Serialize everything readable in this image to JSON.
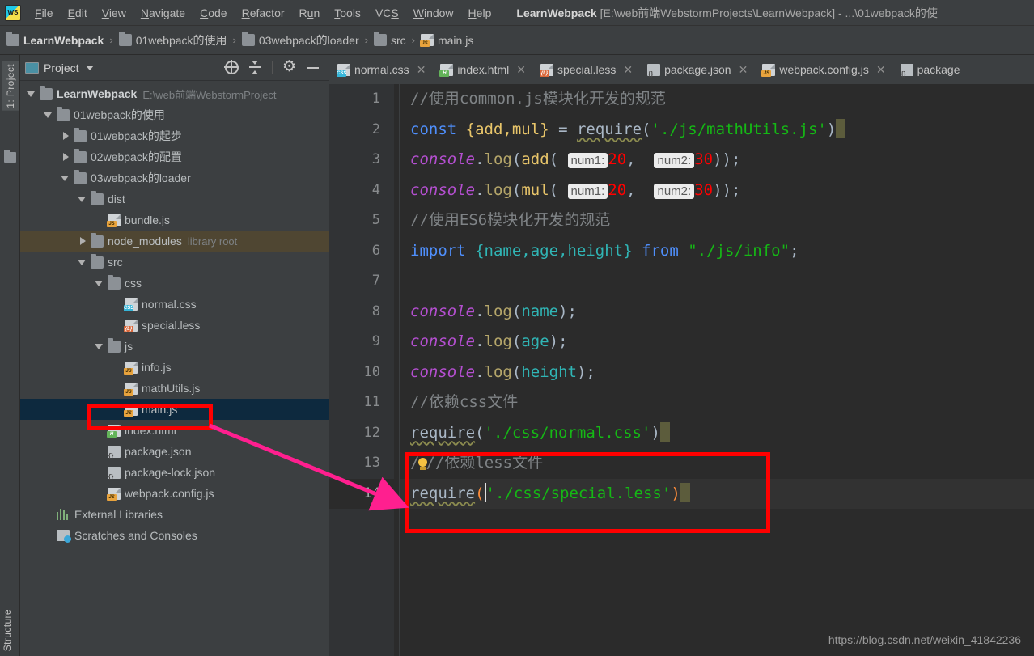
{
  "window": {
    "title_project": "LearnWebpack",
    "title_path": "[E:\\web前端WebstormProjects\\LearnWebpack] - ...\\01webpack的使",
    "logo": "webstorm-logo"
  },
  "menubar": {
    "items": [
      {
        "label": "File",
        "mnemonic": "F"
      },
      {
        "label": "Edit",
        "mnemonic": "E"
      },
      {
        "label": "View",
        "mnemonic": "V"
      },
      {
        "label": "Navigate",
        "mnemonic": "N"
      },
      {
        "label": "Code",
        "mnemonic": "C"
      },
      {
        "label": "Refactor",
        "mnemonic": "R"
      },
      {
        "label": "Run",
        "mnemonic": "u"
      },
      {
        "label": "Tools",
        "mnemonic": "T"
      },
      {
        "label": "VCS",
        "mnemonic": "S"
      },
      {
        "label": "Window",
        "mnemonic": "W"
      },
      {
        "label": "Help",
        "mnemonic": "H"
      }
    ]
  },
  "breadcrumb": {
    "items": [
      {
        "label": "LearnWebpack",
        "icon": "folder-icon",
        "bold": true
      },
      {
        "label": "01webpack的使用",
        "icon": "folder-icon",
        "bold": false
      },
      {
        "label": "03webpack的loader",
        "icon": "folder-icon",
        "bold": false
      },
      {
        "label": "src",
        "icon": "folder-icon",
        "bold": false
      },
      {
        "label": "main.js",
        "icon": "js-file-icon",
        "bold": false
      }
    ],
    "separator": "›"
  },
  "toolstrip": {
    "top_tab": "1: Project",
    "top_tab_mnemonic": "1",
    "bottom_tab": "Structure"
  },
  "project_panel": {
    "title": "Project",
    "tools": [
      "locate-icon",
      "collapse-all-icon",
      "settings-gear-icon",
      "minimize-icon"
    ],
    "tree": [
      {
        "label": "LearnWebpack",
        "sub": "E:\\web前端WebstormProject",
        "indent": 0,
        "twist": "open",
        "icon": "folder-icon",
        "bold": true,
        "state": "normal"
      },
      {
        "label": "01webpack的使用",
        "sub": "",
        "indent": 1,
        "twist": "open",
        "icon": "folder-icon",
        "bold": false,
        "state": "normal"
      },
      {
        "label": "01webpack的起步",
        "sub": "",
        "indent": 2,
        "twist": "closed",
        "icon": "folder-icon",
        "bold": false,
        "state": "normal"
      },
      {
        "label": "02webpack的配置",
        "sub": "",
        "indent": 2,
        "twist": "closed",
        "icon": "folder-icon",
        "bold": false,
        "state": "normal"
      },
      {
        "label": "03webpack的loader",
        "sub": "",
        "indent": 2,
        "twist": "open",
        "icon": "folder-icon",
        "bold": false,
        "state": "normal"
      },
      {
        "label": "dist",
        "sub": "",
        "indent": 3,
        "twist": "open",
        "icon": "folder-icon",
        "bold": false,
        "state": "normal"
      },
      {
        "label": "bundle.js",
        "sub": "",
        "indent": 4,
        "twist": "none",
        "icon": "js-file-icon",
        "bold": false,
        "state": "normal"
      },
      {
        "label": "node_modules",
        "sub": "library root",
        "indent": 3,
        "twist": "closed",
        "icon": "folder-icon",
        "bold": false,
        "state": "library"
      },
      {
        "label": "src",
        "sub": "",
        "indent": 3,
        "twist": "open",
        "icon": "folder-icon",
        "bold": false,
        "state": "normal"
      },
      {
        "label": "css",
        "sub": "",
        "indent": 4,
        "twist": "open",
        "icon": "folder-icon",
        "bold": false,
        "state": "normal"
      },
      {
        "label": "normal.css",
        "sub": "",
        "indent": 5,
        "twist": "none",
        "icon": "css-file-icon",
        "bold": false,
        "state": "normal"
      },
      {
        "label": "special.less",
        "sub": "",
        "indent": 5,
        "twist": "none",
        "icon": "less-file-icon",
        "bold": false,
        "state": "normal"
      },
      {
        "label": "js",
        "sub": "",
        "indent": 4,
        "twist": "open",
        "icon": "folder-icon",
        "bold": false,
        "state": "normal"
      },
      {
        "label": "info.js",
        "sub": "",
        "indent": 5,
        "twist": "none",
        "icon": "js-file-icon",
        "bold": false,
        "state": "normal"
      },
      {
        "label": "mathUtils.js",
        "sub": "",
        "indent": 5,
        "twist": "none",
        "icon": "js-file-icon",
        "bold": false,
        "state": "normal"
      },
      {
        "label": "main.js",
        "sub": "",
        "indent": 5,
        "twist": "none",
        "icon": "js-file-icon",
        "bold": false,
        "state": "selected"
      },
      {
        "label": "index.html",
        "sub": "",
        "indent": 4,
        "twist": "none",
        "icon": "html-file-icon",
        "bold": false,
        "state": "normal"
      },
      {
        "label": "package.json",
        "sub": "",
        "indent": 4,
        "twist": "none",
        "icon": "json-file-icon",
        "bold": false,
        "state": "normal"
      },
      {
        "label": "package-lock.json",
        "sub": "",
        "indent": 4,
        "twist": "none",
        "icon": "json-file-icon",
        "bold": false,
        "state": "normal"
      },
      {
        "label": "webpack.config.js",
        "sub": "",
        "indent": 4,
        "twist": "none",
        "icon": "js-file-icon",
        "bold": false,
        "state": "normal"
      },
      {
        "label": "External Libraries",
        "sub": "",
        "indent": 1,
        "twist": "none",
        "icon": "libraries-icon",
        "bold": false,
        "state": "normal"
      },
      {
        "label": "Scratches and Consoles",
        "sub": "",
        "indent": 1,
        "twist": "none",
        "icon": "scratches-icon",
        "bold": false,
        "state": "normal"
      }
    ]
  },
  "editor": {
    "tabs": [
      {
        "label": "normal.css",
        "icon": "css-file-icon",
        "active": false,
        "closable": true
      },
      {
        "label": "index.html",
        "icon": "html-file-icon",
        "active": false,
        "closable": true
      },
      {
        "label": "special.less",
        "icon": "less-file-icon",
        "active": false,
        "closable": true
      },
      {
        "label": "package.json",
        "icon": "json-file-icon",
        "active": false,
        "closable": true
      },
      {
        "label": "webpack.config.js",
        "icon": "js-file-icon",
        "active": false,
        "closable": true
      },
      {
        "label": "package",
        "icon": "json-file-icon",
        "active": false,
        "closable": false
      }
    ],
    "line_numbers": [
      1,
      2,
      3,
      4,
      5,
      6,
      7,
      8,
      9,
      10,
      11,
      12,
      13,
      14
    ],
    "current_line": 14,
    "lines": [
      {
        "n": 1,
        "text": "//使用common.js模块化开发的规范"
      },
      {
        "n": 2,
        "text": "const {add,mul} = require('./js/mathUtils.js')"
      },
      {
        "n": 3,
        "text": "console.log(add( num1: 20,  num2: 30));"
      },
      {
        "n": 4,
        "text": "console.log(mul( num1: 20,  num2: 30));"
      },
      {
        "n": 5,
        "text": "//使用ES6模块化开发的规范"
      },
      {
        "n": 6,
        "text": "import {name,age,height} from \"./js/info\";"
      },
      {
        "n": 7,
        "text": ""
      },
      {
        "n": 8,
        "text": "console.log(name);"
      },
      {
        "n": 9,
        "text": "console.log(age);"
      },
      {
        "n": 10,
        "text": "console.log(height);"
      },
      {
        "n": 11,
        "text": "//依赖css文件"
      },
      {
        "n": 12,
        "text": "require('./css/normal.css')"
      },
      {
        "n": 13,
        "text": "//依赖less文件"
      },
      {
        "n": 14,
        "text": "require('./css/special.less')"
      }
    ],
    "tokens": {
      "comment1": "//使用common.js模块化开发的规范",
      "const_kw": "const",
      "destructure1": "{add,mul}",
      "equals": "=",
      "require_fn": "require",
      "path_mathutils": "'./js/mathUtils.js'",
      "console_obj": "console",
      "log_fn": "log",
      "add_fn": "add",
      "mul_fn": "mul",
      "hint_num1": "num1:",
      "hint_num2": "num2:",
      "val_20": "20",
      "val_30": "30",
      "comment2": "//使用ES6模块化开发的规范",
      "import_kw": "import",
      "destructure2": "{name,age,height}",
      "from_kw": "from",
      "path_info": "\"./js/info\"",
      "var_name": "name",
      "var_age": "age",
      "var_height": "height",
      "comment3": "//依赖css文件",
      "path_normalcss": "'./css/normal.css'",
      "comment4": "//依赖less文件",
      "path_speciallesss": "'./css/special.less'"
    }
  },
  "annotations": {
    "box_color": "#ff0000",
    "arrow_color": "#ff1f8f",
    "box_mainjs_target": "main.js",
    "box_code_target": "require('./css/special.less')"
  },
  "watermark": "https://blog.csdn.net/weixin_41842236",
  "colors": {
    "chrome_bg": "#3c3f41",
    "editor_bg": "#2b2b2b",
    "gutter_bg": "#313335",
    "selection_bg": "#0d293e",
    "library_bg": "#4f4632",
    "accent_red": "#ff0000",
    "accent_pink": "#ff1f8f",
    "string_green": "#15b815",
    "keyword_blue": "#4f8ffc",
    "number_red": "#ff0000"
  }
}
